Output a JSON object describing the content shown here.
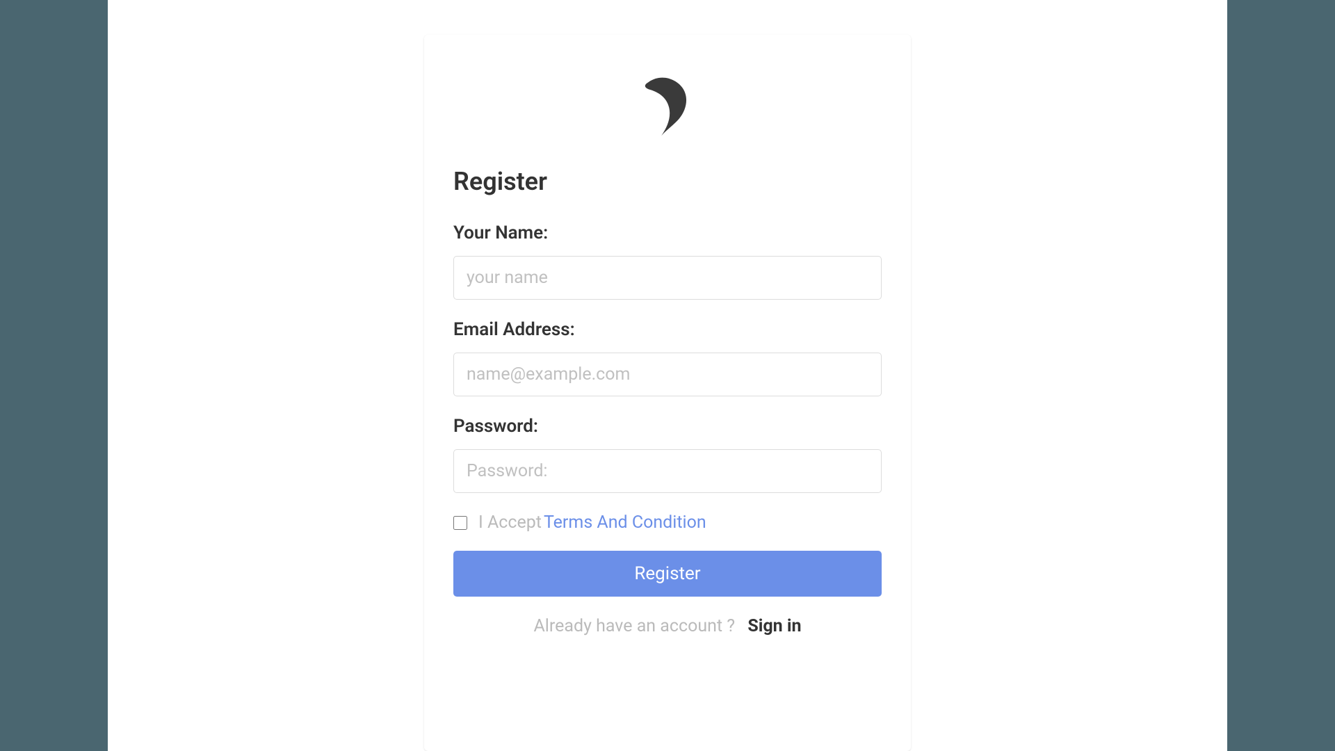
{
  "page": {
    "title": "Register"
  },
  "form": {
    "name": {
      "label": "Your Name:",
      "placeholder": "your name",
      "value": ""
    },
    "email": {
      "label": "Email Address:",
      "placeholder": "name@example.com",
      "value": ""
    },
    "password": {
      "label": "Password:",
      "placeholder": "Password:",
      "value": ""
    },
    "terms": {
      "accept_text": "I Accept",
      "link_text": "Terms And Condition",
      "checked": false
    },
    "submit_label": "Register"
  },
  "footer": {
    "already_text": "Already have an account ?",
    "signin_label": "Sign in"
  },
  "colors": {
    "primary": "#6b8fe8",
    "text_dark": "#333333",
    "text_muted": "#bababa",
    "border": "#dcdcdc",
    "background_outer": "#4a6670"
  }
}
